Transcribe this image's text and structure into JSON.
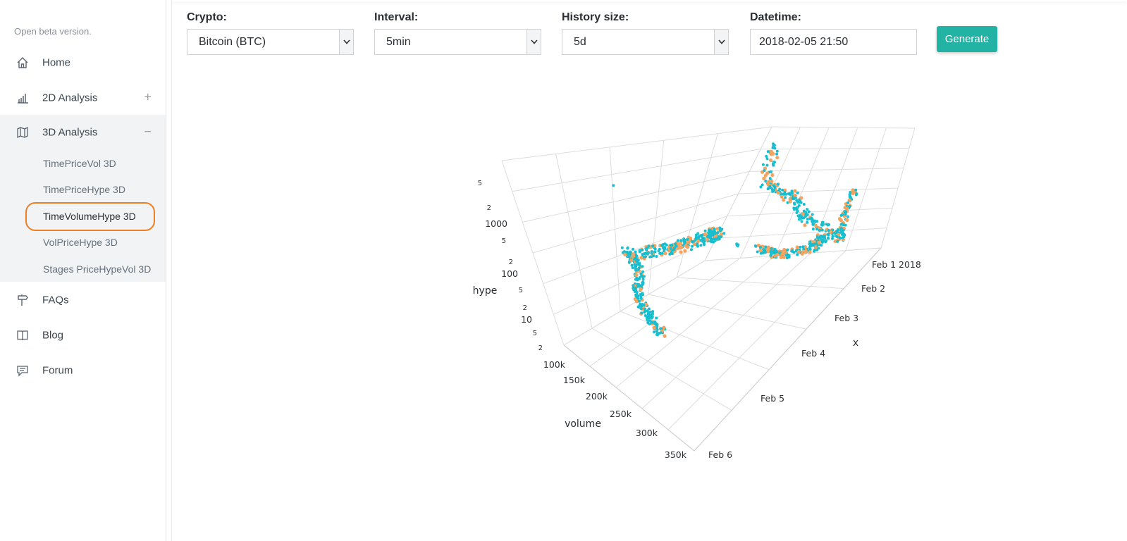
{
  "sidebar": {
    "beta_notice": "Open beta version.",
    "items": [
      {
        "label": "Home",
        "icon": "home-icon"
      },
      {
        "label": "2D Analysis",
        "icon": "bar-chart-icon",
        "toggle": "+"
      },
      {
        "label": "3D Analysis",
        "icon": "map-icon",
        "toggle": "−"
      },
      {
        "label": "FAQs",
        "icon": "signpost-icon"
      },
      {
        "label": "Blog",
        "icon": "book-icon"
      },
      {
        "label": "Forum",
        "icon": "chat-icon"
      }
    ],
    "submenu": [
      {
        "label": "TimePriceVol 3D"
      },
      {
        "label": "TimePriceHype 3D"
      },
      {
        "label": "TimeVolumeHype 3D"
      },
      {
        "label": "VolPriceHype 3D"
      },
      {
        "label": "Stages PriceHypeVol 3D"
      }
    ]
  },
  "form": {
    "crypto_label": "Crypto:",
    "crypto_value": "Bitcoin (BTC)",
    "interval_label": "Interval:",
    "interval_value": "5min",
    "history_label": "History size:",
    "history_value": "5d",
    "datetime_label": "Datetime:",
    "datetime_value": "2018-02-05 21:50",
    "generate_label": "Generate"
  },
  "colors": {
    "accent": "#23b3a5",
    "points_primary": "#17becf",
    "points_secondary": "#f4a460",
    "highlight": "#f07f24"
  },
  "chart_data": {
    "type": "scatter3d",
    "axes": {
      "x": {
        "label": "x",
        "ticks": [
          "Feb 1 2018",
          "Feb 2",
          "Feb 3",
          "Feb 4",
          "Feb 5",
          "Feb 6"
        ]
      },
      "y": {
        "label": "volume",
        "ticks": [
          "100k",
          "150k",
          "200k",
          "250k",
          "300k",
          "350k"
        ]
      },
      "z": {
        "label": "hype",
        "scale": "log",
        "ticks": [
          "2",
          "5",
          "10",
          "2",
          "5",
          "100",
          "2",
          "5",
          "1000",
          "2",
          "5"
        ]
      }
    }
  }
}
